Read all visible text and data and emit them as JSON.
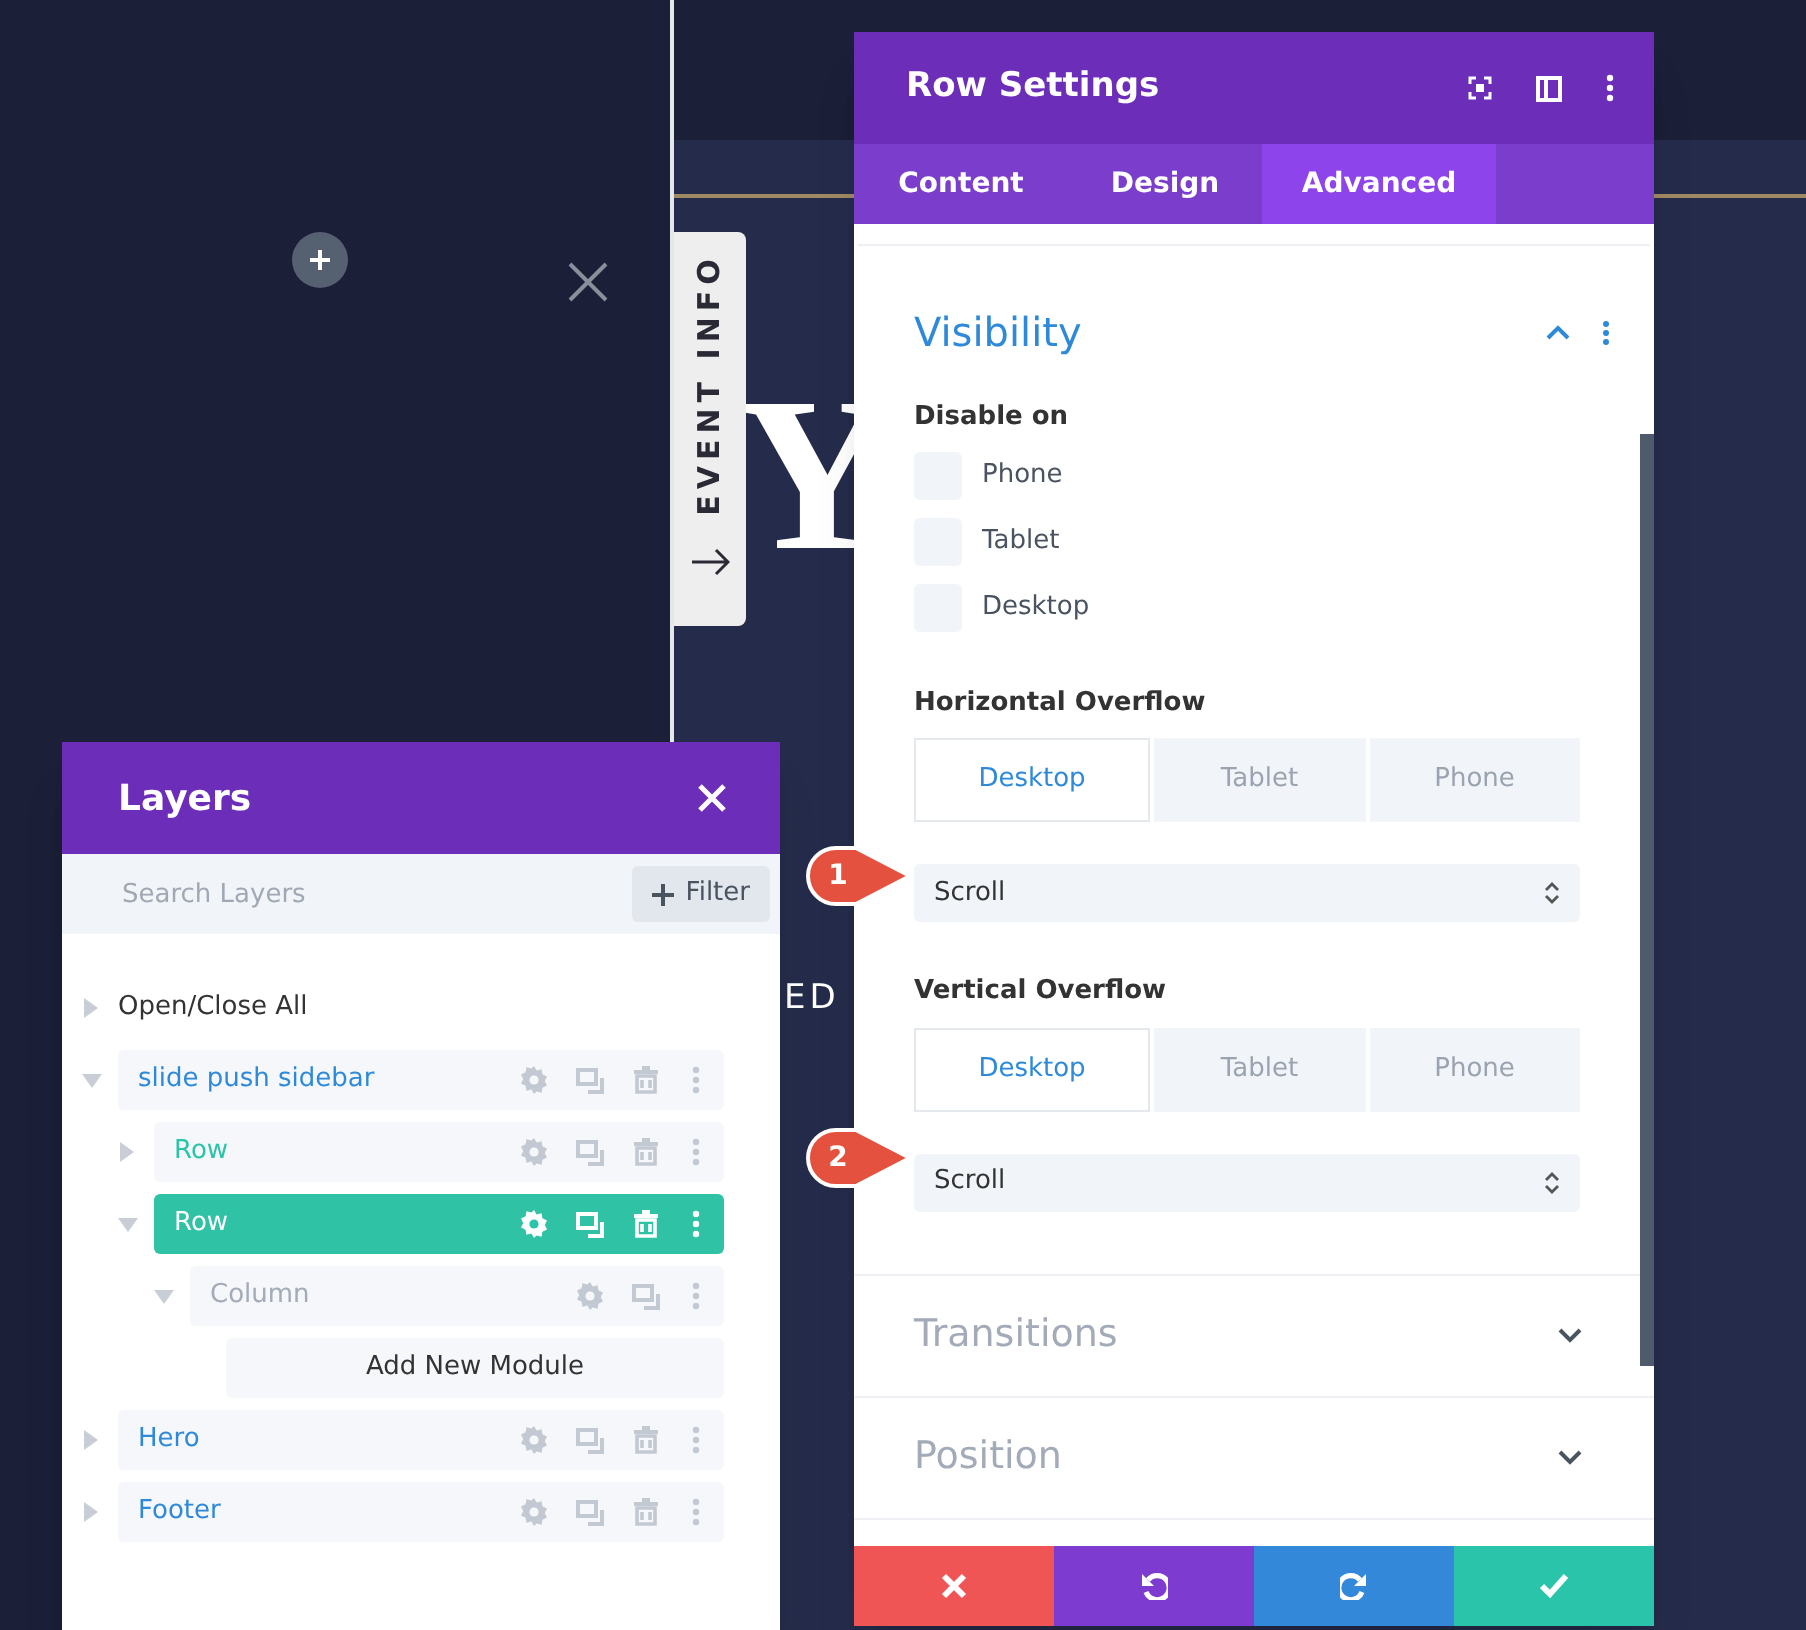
{
  "page": {
    "hero_texts": [
      "Y",
      "ED"
    ],
    "side_tab": {
      "label": "EVENT INFO"
    }
  },
  "row_settings": {
    "title": "Row Settings",
    "tabs": [
      {
        "label": "Content",
        "selected": false
      },
      {
        "label": "Design",
        "selected": false
      },
      {
        "label": "Advanced",
        "selected": true
      }
    ],
    "visibility": {
      "title": "Visibility",
      "expanded": true,
      "disable_label": "Disable on",
      "options": [
        {
          "label": "Phone",
          "checked": false
        },
        {
          "label": "Tablet",
          "checked": false
        },
        {
          "label": "Desktop",
          "checked": false
        }
      ],
      "overflow_groups": [
        {
          "label": "Horizontal Overflow",
          "devices": [
            {
              "label": "Desktop",
              "selected": true
            },
            {
              "label": "Tablet",
              "selected": false
            },
            {
              "label": "Phone",
              "selected": false
            }
          ],
          "value": "Scroll",
          "callout": "1"
        },
        {
          "label": "Vertical Overflow",
          "devices": [
            {
              "label": "Desktop",
              "selected": true
            },
            {
              "label": "Tablet",
              "selected": false
            },
            {
              "label": "Phone",
              "selected": false
            }
          ],
          "value": "Scroll",
          "callout": "2"
        }
      ]
    },
    "sections": [
      {
        "title": "Transitions",
        "expanded": false
      },
      {
        "title": "Position",
        "expanded": false
      }
    ],
    "actions": [
      {
        "kind": "discard"
      },
      {
        "kind": "undo"
      },
      {
        "kind": "redo"
      },
      {
        "kind": "save"
      }
    ]
  },
  "layers": {
    "title": "Layers",
    "search": {
      "placeholder": "Search Layers"
    },
    "filter": {
      "label": "Filter"
    },
    "open_close": "Open/Close All",
    "tree": [
      {
        "kind": "section",
        "label": "slide push sidebar",
        "expanded": true,
        "selected": false,
        "children": [
          {
            "kind": "row",
            "label": "Row",
            "expanded": false,
            "selected": false
          },
          {
            "kind": "row",
            "label": "Row",
            "expanded": true,
            "selected": true,
            "children": [
              {
                "kind": "column",
                "label": "Column",
                "expanded": true,
                "selected": false,
                "children": [
                  {
                    "kind": "add",
                    "label": "Add New Module"
                  }
                ]
              }
            ]
          }
        ]
      },
      {
        "kind": "section",
        "label": "Hero",
        "expanded": false,
        "selected": false
      },
      {
        "kind": "section",
        "label": "Footer",
        "expanded": false,
        "selected": false
      }
    ]
  }
}
